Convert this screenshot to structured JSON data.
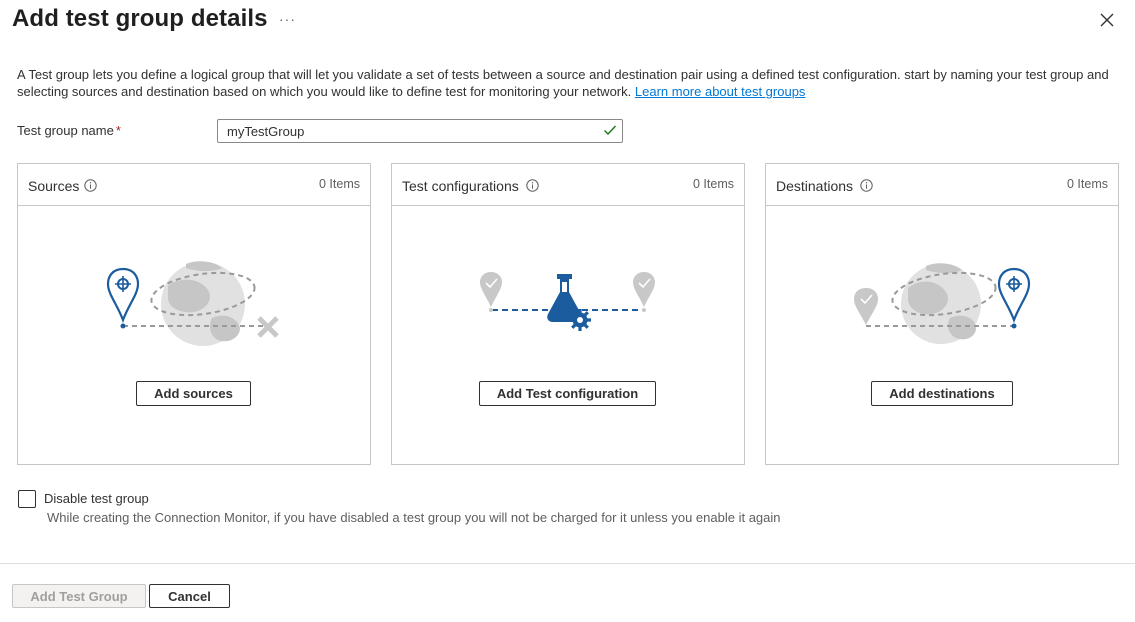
{
  "header": {
    "title": "Add test group details",
    "more_label": "···"
  },
  "description": {
    "text": "A Test group lets you define a logical group that will let you validate a set of tests between a source and destination pair using a defined test configuration. start by naming your test group and selecting sources and destination based on which you would like to define test for monitoring your network.",
    "link": "Learn more about test groups"
  },
  "name_field": {
    "label": "Test group name",
    "required_marker": "*",
    "value": "myTestGroup"
  },
  "panels": [
    {
      "title": "Sources",
      "count": "0 Items",
      "button": "Add sources"
    },
    {
      "title": "Test configurations",
      "count": "0 Items",
      "button": "Add Test configuration"
    },
    {
      "title": "Destinations",
      "count": "0 Items",
      "button": "Add destinations"
    }
  ],
  "disable": {
    "checked": false,
    "label": "Disable test group",
    "help": "While creating the Connection Monitor, if you have disabled a test group you will not be charged for it unless you enable it again"
  },
  "footer": {
    "primary_label": "Add Test Group",
    "cancel_label": "Cancel"
  },
  "colors": {
    "accent": "#0078d4",
    "pin_blue": "#1b5c9e",
    "required": "#a4262c",
    "valid_check": "#107c10",
    "illustration_gray": "#c8c8c8"
  },
  "icons": [
    "more-icon",
    "close-icon",
    "check-icon",
    "info-icon",
    "globe-icon",
    "location-pin-icon",
    "flask-icon",
    "gear-icon",
    "x-mark-icon"
  ]
}
